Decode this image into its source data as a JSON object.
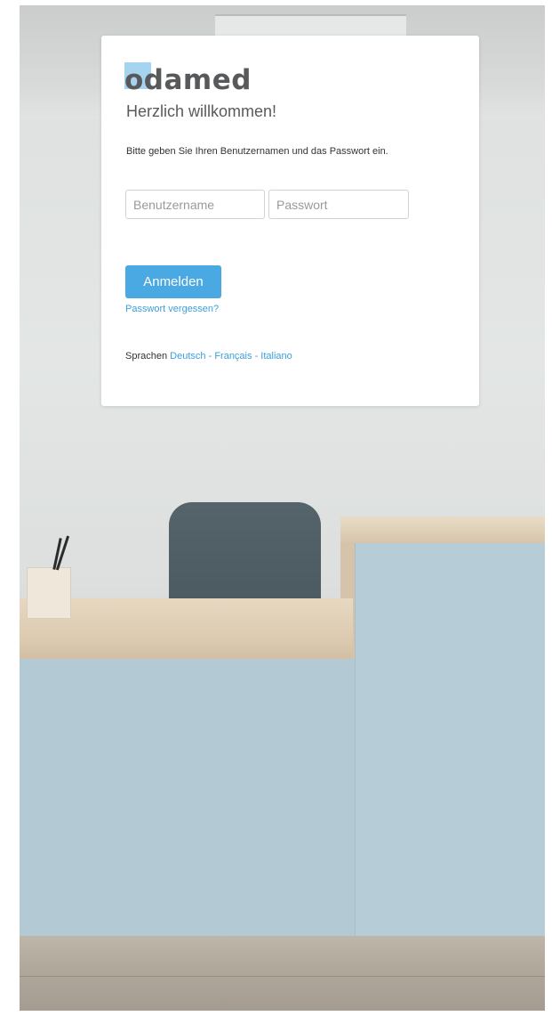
{
  "brand": {
    "name": "odamed",
    "accent_color": "#a6d3ef"
  },
  "login": {
    "welcome": "Herzlich willkommen!",
    "instruction": "Bitte geben Sie Ihren Benutzernamen und das Passwort ein.",
    "username": {
      "placeholder": "Benutzername",
      "value": ""
    },
    "password": {
      "placeholder": "Passwort",
      "value": ""
    },
    "submit_label": "Anmelden",
    "forgot_label": "Passwort vergessen?",
    "button_color": "#4aa8e2",
    "link_color": "#3aa0de"
  },
  "languages": {
    "label": "Sprachen",
    "separator": "-",
    "items": [
      {
        "label": "Deutsch"
      },
      {
        "label": "Français"
      },
      {
        "label": "Italiano"
      }
    ]
  }
}
